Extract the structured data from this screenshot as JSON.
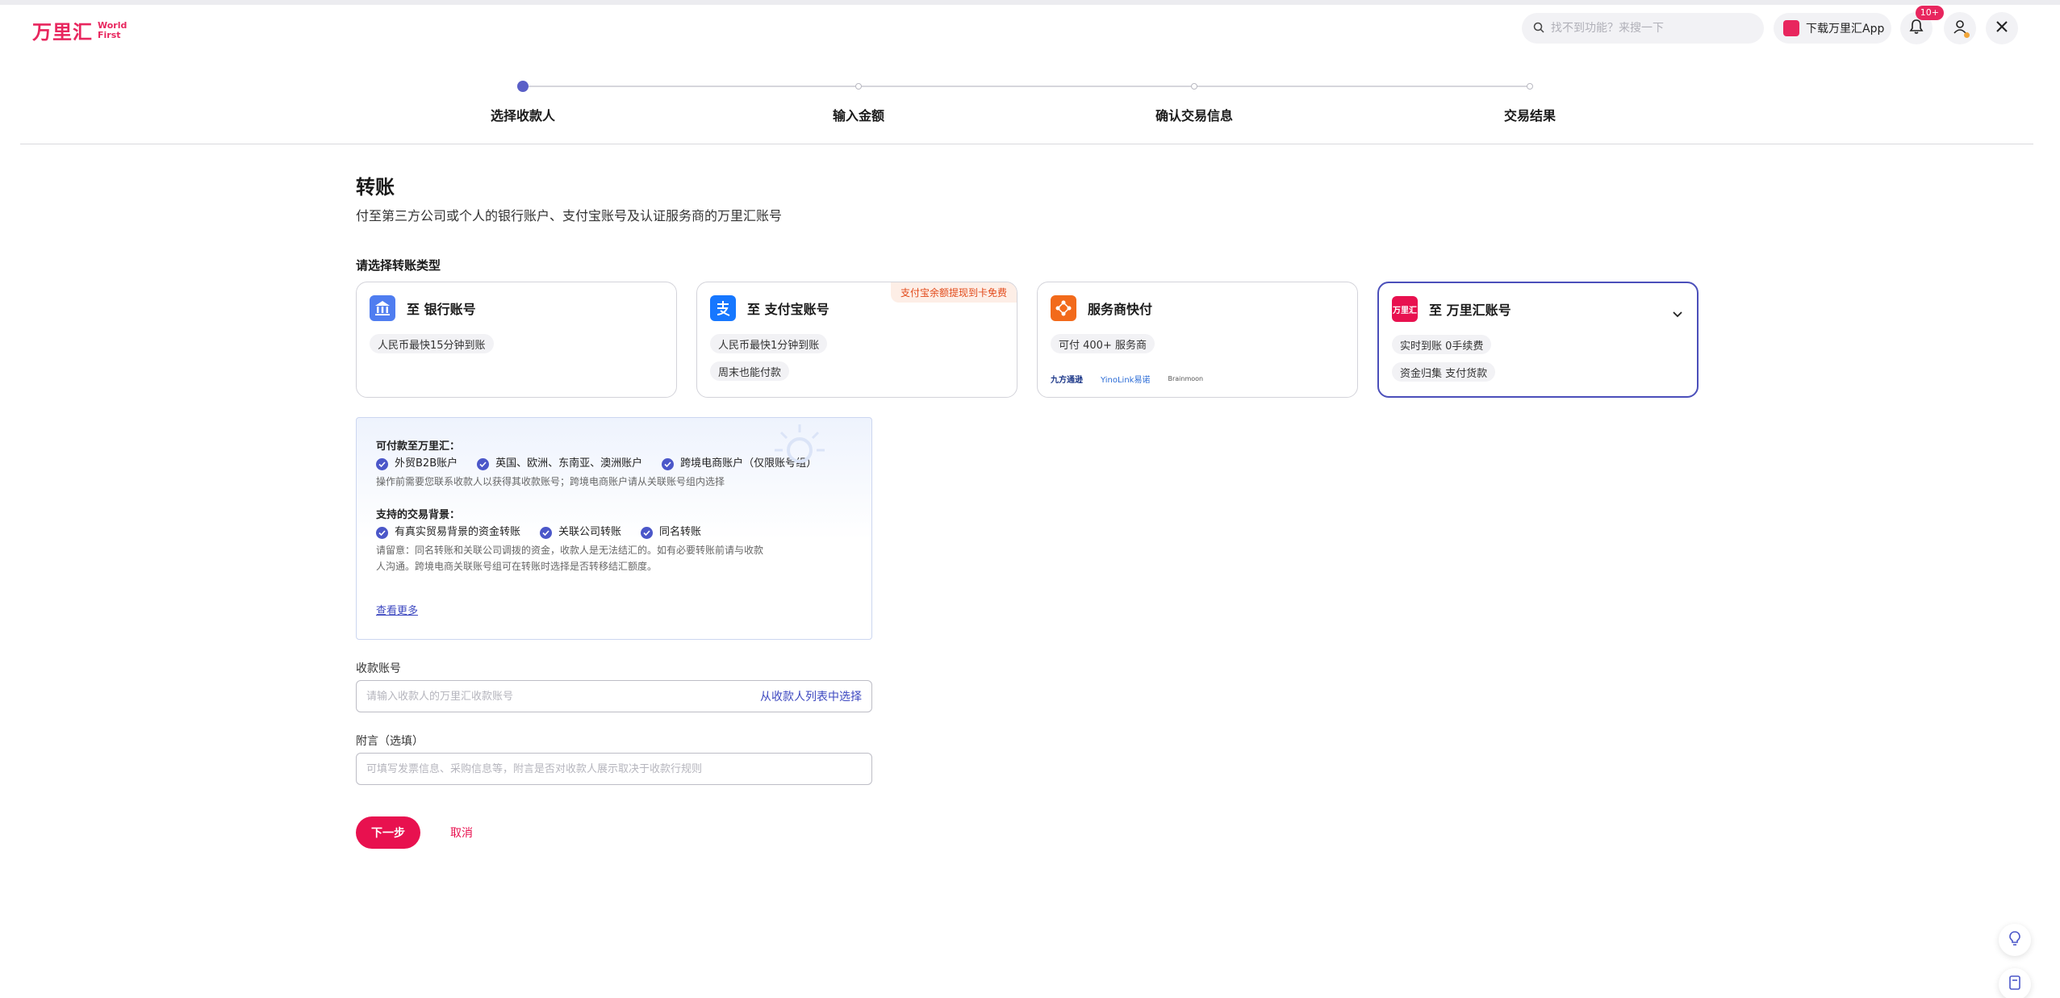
{
  "header": {
    "logo_cn": "万里汇",
    "logo_en_1": "World",
    "logo_en_2": "First",
    "search_placeholder": "找不到功能？来搜一下",
    "download_app": "下载万里汇App",
    "notification_badge": "10+"
  },
  "stepper": {
    "steps": [
      {
        "label": "选择收款人",
        "active": true
      },
      {
        "label": "输入金额",
        "active": false
      },
      {
        "label": "确认交易信息",
        "active": false
      },
      {
        "label": "交易结果",
        "active": false
      }
    ]
  },
  "page": {
    "title": "转账",
    "subtitle": "付至第三方公司或个人的银行账户、支付宝账号及认证服务商的万里汇账号",
    "section_label": "请选择转账类型"
  },
  "cards": [
    {
      "title": "至 银行账号",
      "tags": [
        "人民币最快15分钟到账"
      ],
      "selected": false
    },
    {
      "title": "至 支付宝账号",
      "tags": [
        "人民币最快1分钟到账",
        "周末也能付款"
      ],
      "corner": "支付宝余额提现到卡免费",
      "selected": false
    },
    {
      "title": "服务商快付",
      "tags": [
        "可付 400+ 服务商"
      ],
      "partners": [
        "九方通逊",
        "YinoLink易诺",
        "Brainmoon"
      ],
      "selected": false
    },
    {
      "title": "至 万里汇账号",
      "icon_text": "万里汇",
      "tags": [
        "实时到账 0手续费",
        "资金归集 支付货款"
      ],
      "selected": true
    }
  ],
  "info": {
    "payable_title": "可付款至万里汇：",
    "payable_items": [
      "外贸B2B账户",
      "英国、欧洲、东南亚、澳洲账户",
      "跨境电商账户（仅限账号组）"
    ],
    "payable_note": "操作前需要您联系收款人以获得其收款账号；跨境电商账户请从关联账号组内选择",
    "context_title": "支持的交易背景：",
    "context_items": [
      "有真实贸易背景的资金转账",
      "关联公司转账",
      "同名转账"
    ],
    "context_note_1": "请留意：同名转账和关联公司调拨的资金，收款人是无法结汇的。如有必要转账前请与收款",
    "context_note_2": "人沟通。跨境电商关联账号组可在转账时选择是否转移结汇额度。",
    "more_link": "查看更多"
  },
  "form": {
    "account_label": "收款账号",
    "account_placeholder": "请输入收款人的万里汇收款账号",
    "account_link": "从收款人列表中选择",
    "memo_label": "附言（选填）",
    "memo_placeholder": "可填写发票信息、采购信息等，附言是否对收款人展示取决于收款行规则"
  },
  "actions": {
    "next": "下一步",
    "cancel": "取消"
  },
  "colors": {
    "brand": "#e8114f",
    "accent": "#4b4fba"
  }
}
